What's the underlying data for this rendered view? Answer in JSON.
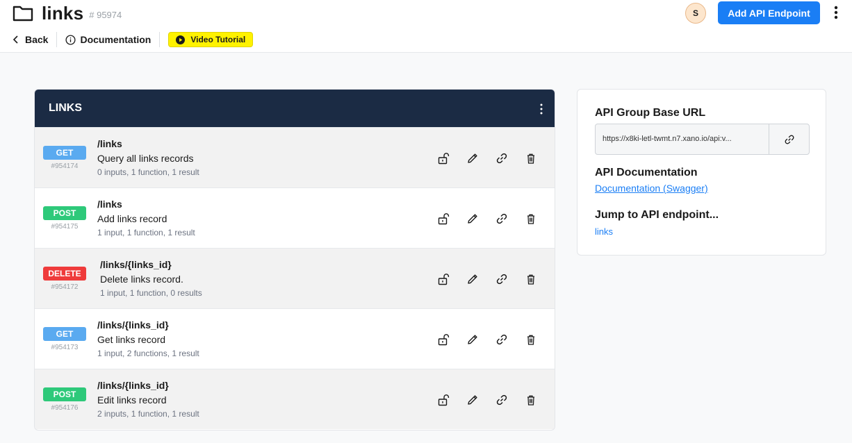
{
  "header": {
    "title": "links",
    "id": "# 95974",
    "back_label": "Back",
    "docs_label": "Documentation",
    "video_label": "Video Tutorial",
    "avatar_initial": "S",
    "add_button_label": "Add API Endpoint"
  },
  "panel": {
    "title": "LINKS",
    "endpoints": [
      {
        "method": "GET",
        "color": "#5aaaf0",
        "id": "#954174",
        "path": "/links",
        "description": "Query all links records",
        "meta": "0 inputs, 1 function, 1 result"
      },
      {
        "method": "POST",
        "color": "#2ec97a",
        "id": "#954175",
        "path": "/links",
        "description": "Add links record",
        "meta": "1 input, 1 function, 1 result"
      },
      {
        "method": "DELETE",
        "color": "#ef3b3b",
        "id": "#954172",
        "path": "/links/{links_id}",
        "description": "Delete links record.",
        "meta": "1 input, 1 function, 0 results"
      },
      {
        "method": "GET",
        "color": "#5aaaf0",
        "id": "#954173",
        "path": "/links/{links_id}",
        "description": "Get links record",
        "meta": "1 input, 2 functions, 1 result"
      },
      {
        "method": "POST",
        "color": "#2ec97a",
        "id": "#954176",
        "path": "/links/{links_id}",
        "description": "Edit links record",
        "meta": "2 inputs, 1 function, 1 result"
      }
    ]
  },
  "side": {
    "base_url_heading": "API Group Base URL",
    "base_url": "https://x8ki-letl-twmt.n7.xano.io/api:v...",
    "doc_heading": "API Documentation",
    "doc_link": "Documentation (Swagger)",
    "jump_heading": "Jump to API endpoint...",
    "jump_link": "links"
  },
  "icons": {
    "header": [
      "folder-icon",
      "chevron-left-icon",
      "info-icon",
      "play-icon",
      "kebab-icon"
    ],
    "row_actions": [
      "unlock-icon",
      "pencil-icon",
      "link-icon",
      "trash-icon"
    ]
  },
  "colors": {
    "accent": "#1a7ef5",
    "panel_header": "#1b2b44",
    "video_button": "#fff200"
  }
}
